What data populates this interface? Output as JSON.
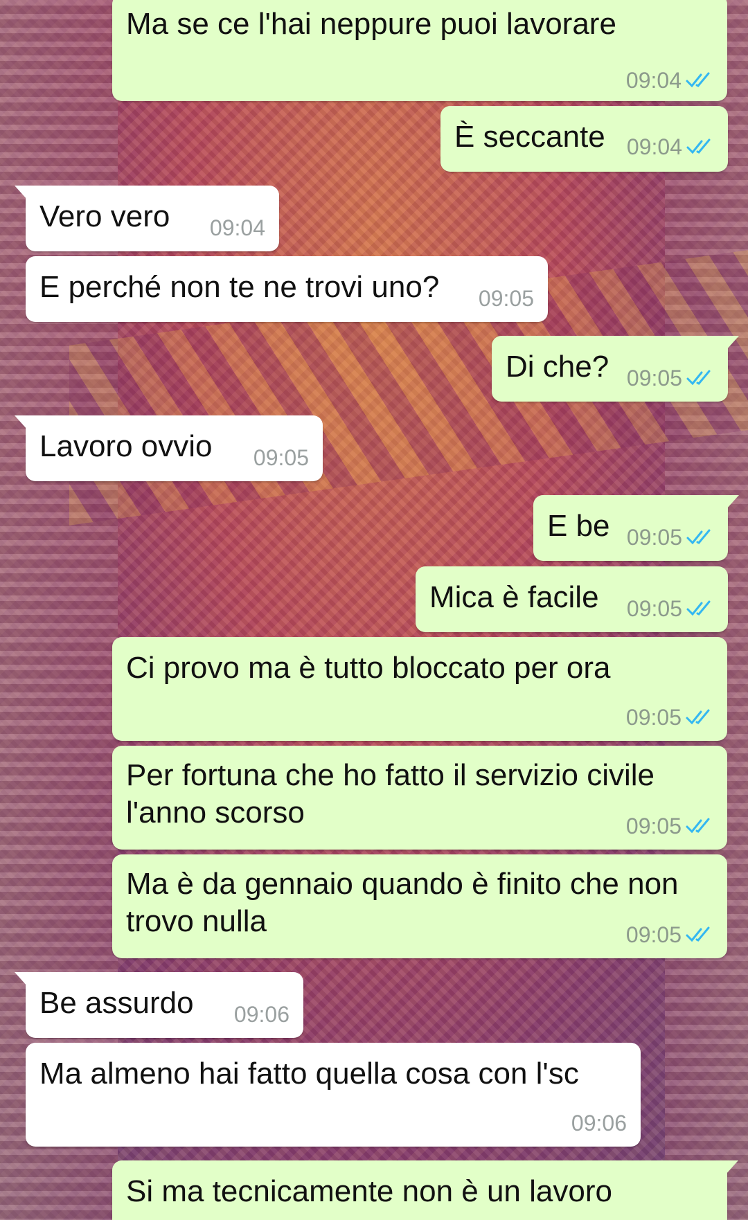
{
  "messages": [
    {
      "text": "Ma se ce l'hai neppure puoi lavorare",
      "time": "09:04",
      "dir": "out",
      "read": true
    },
    {
      "text": "È seccante",
      "time": "09:04",
      "dir": "out",
      "read": true
    },
    {
      "text": "Vero vero",
      "time": "09:04",
      "dir": "in"
    },
    {
      "text": "E perché non te ne trovi uno?",
      "time": "09:05",
      "dir": "in"
    },
    {
      "text": "Di che?",
      "time": "09:05",
      "dir": "out",
      "read": true
    },
    {
      "text": "Lavoro ovvio",
      "time": "09:05",
      "dir": "in"
    },
    {
      "text": "E be",
      "time": "09:05",
      "dir": "out",
      "read": true
    },
    {
      "text": "Mica è facile",
      "time": "09:05",
      "dir": "out",
      "read": true
    },
    {
      "text": "Ci provo ma è tutto bloccato per ora",
      "time": "09:05",
      "dir": "out",
      "read": true
    },
    {
      "text": "Per fortuna che ho fatto il servizio civile l'anno scorso",
      "time": "09:05",
      "dir": "out",
      "read": true
    },
    {
      "text": "Ma è da gennaio quando è finito che non trovo nulla",
      "time": "09:05",
      "dir": "out",
      "read": true
    },
    {
      "text": "Be assurdo",
      "time": "09:06",
      "dir": "in"
    },
    {
      "text": "Ma almeno hai fatto quella cosa con l'sc",
      "time": "09:06",
      "dir": "in"
    },
    {
      "text": "Si ma tecnicamente non è un lavoro",
      "time": "",
      "dir": "out"
    }
  ],
  "colors": {
    "outgoing_bubble": "#e2ffc8",
    "incoming_bubble": "#ffffff",
    "read_ticks": "#34b7f1",
    "timestamp": "#8c9a8c"
  },
  "icons": {
    "read_receipt": "double-check-icon"
  }
}
